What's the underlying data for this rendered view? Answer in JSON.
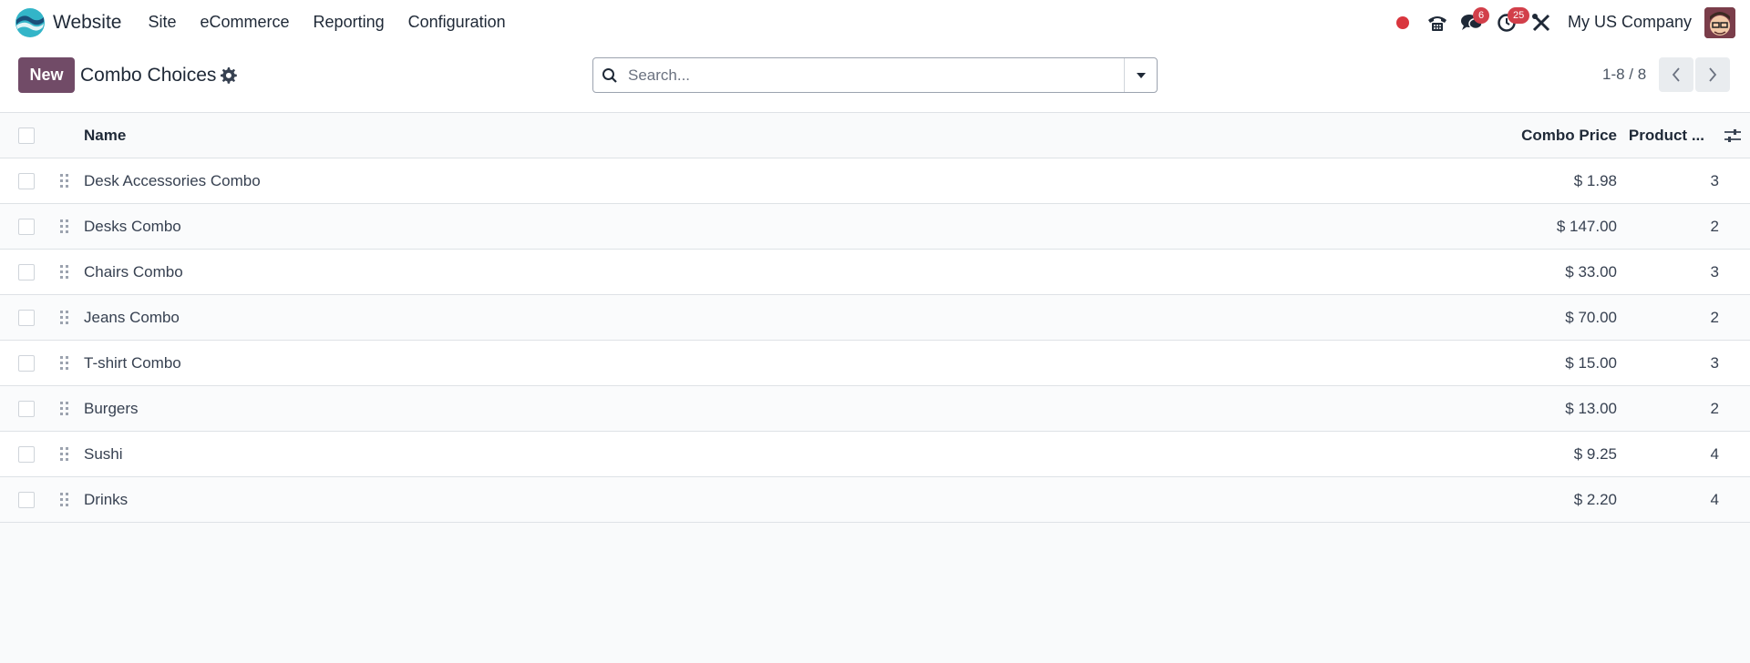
{
  "navbar": {
    "app_name": "Website",
    "menu": [
      "Site",
      "eCommerce",
      "Reporting",
      "Configuration"
    ],
    "systray": {
      "messages_badge": "6",
      "activities_badge": "25",
      "company": "My US Company"
    }
  },
  "control_panel": {
    "new_label": "New",
    "title": "Combo Choices",
    "search_placeholder": "Search...",
    "pager": "1-8 / 8"
  },
  "table": {
    "columns": {
      "name": "Name",
      "price": "Combo Price",
      "count": "Product ..."
    },
    "rows": [
      {
        "name": "Desk Accessories Combo",
        "price": "$ 1.98",
        "count": "3"
      },
      {
        "name": "Desks Combo",
        "price": "$ 147.00",
        "count": "2"
      },
      {
        "name": "Chairs Combo",
        "price": "$ 33.00",
        "count": "3"
      },
      {
        "name": "Jeans Combo",
        "price": "$ 70.00",
        "count": "2"
      },
      {
        "name": "T-shirt Combo",
        "price": "$ 15.00",
        "count": "3"
      },
      {
        "name": "Burgers",
        "price": "$ 13.00",
        "count": "2"
      },
      {
        "name": "Sushi",
        "price": "$ 9.25",
        "count": "4"
      },
      {
        "name": "Drinks",
        "price": "$ 2.20",
        "count": "4"
      }
    ]
  },
  "colors": {
    "primary": "#714b67",
    "badge": "#d23f4a",
    "recording": "#d9363e"
  }
}
